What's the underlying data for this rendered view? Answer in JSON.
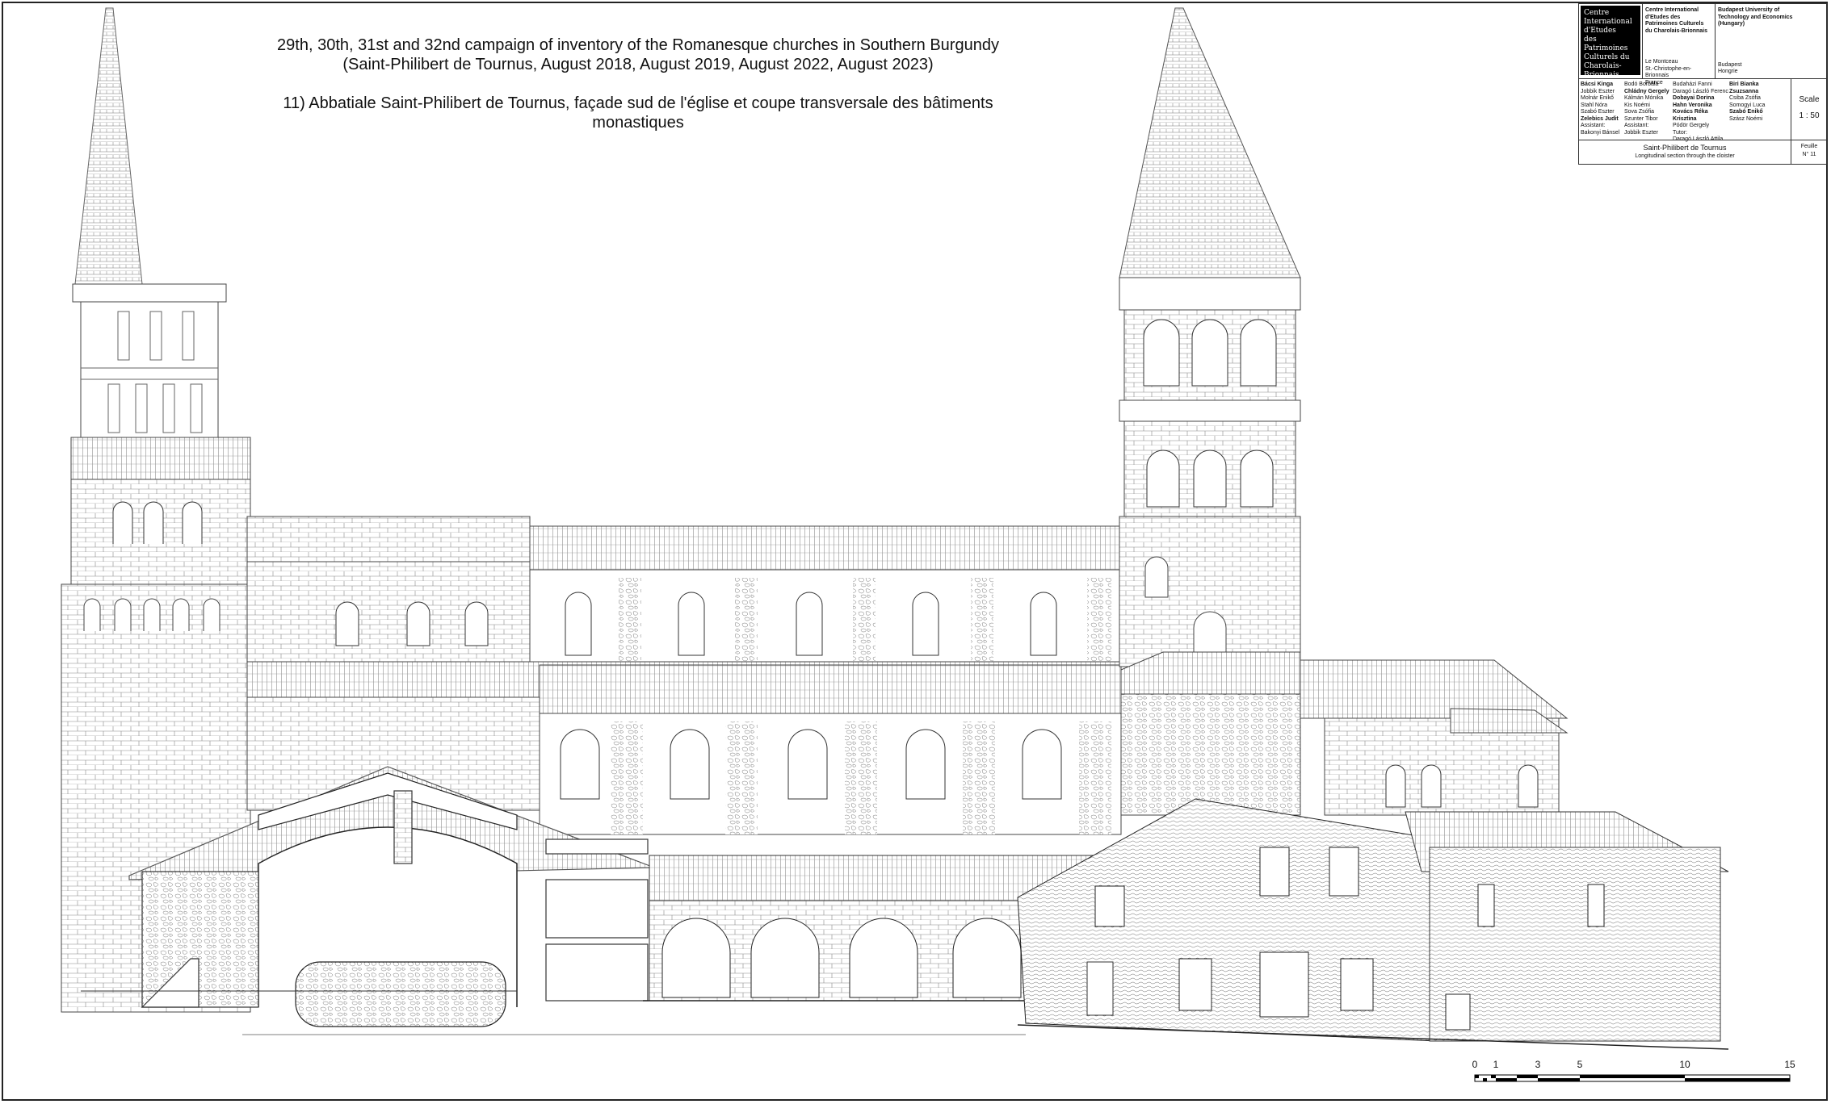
{
  "header": {
    "line1": "29th, 30th, 31st and 32nd campaign of inventory of the Romanesque churches in Southern Burgundy",
    "line2": "(Saint-Philibert de Tournus, August 2018, August 2019, August 2022, August 2023)",
    "line3": "11) Abbatiale Saint-Philibert de Tournus, façade sud de l'église et coupe transversale des bâtiments monastiques"
  },
  "title_block": {
    "logo_lines": [
      "Centre",
      "International",
      "d'Etudes",
      "des Patrimoines",
      "Culturels du",
      "Charolais-Brionnais"
    ],
    "institution1": {
      "name_lines": [
        "Centre International",
        "d'Etudes des",
        "Patrimoines Culturels",
        "du Charolais-Brionnais"
      ],
      "address_lines": [
        "Le Montceau",
        "St.-Christophe-en-Brionnais",
        "France"
      ]
    },
    "institution2": {
      "name_lines": [
        "Budapest University of",
        "Technology and Economics",
        "(Hungary)"
      ],
      "address_lines": [
        "Budapest",
        "Hongrie"
      ]
    },
    "team_col1": [
      "Bácsi Kinga",
      "Jobbik Eszter",
      "Molnár Enikő",
      "Stahl Nóra",
      "Szabó Eszter",
      "Zelebics Judit",
      "",
      "Assistant:",
      "Bakonyi Bánsel"
    ],
    "team_col2": [
      "Bodó Borbála",
      "Chládny Gergely",
      "Kálmán Mónika",
      "Kis Noémi",
      "Sova Zsófia",
      "Szunter Tibor",
      "",
      "Assistant:",
      "Jobbik Eszter"
    ],
    "team_col3": [
      "Budaházi Fanni",
      "Daragó László Ferenc",
      "Dobayai Dorina",
      "Hahn Veronika",
      "Kovács Réka Krisztina",
      "Pódör Gergely",
      "",
      "Tutor:",
      "Daragó László Attila"
    ],
    "team_col4": [
      "Biri Bianka Zsuzsanna",
      "Csiba Zsófia",
      "Somogyi Luca",
      "Szabó Enikő",
      "Szász Noémi"
    ],
    "scale_label": "Scale",
    "scale_value": "1 : 50",
    "drawing_title": "Saint-Philibert de Tournus",
    "drawing_subtitle": "Longitudinal section through the cloister",
    "sheet_label": "Feuille",
    "sheet_number": "N° 11"
  },
  "scale_bar": {
    "labels": [
      "0",
      "1",
      "3",
      "5",
      "10",
      "15"
    ]
  }
}
